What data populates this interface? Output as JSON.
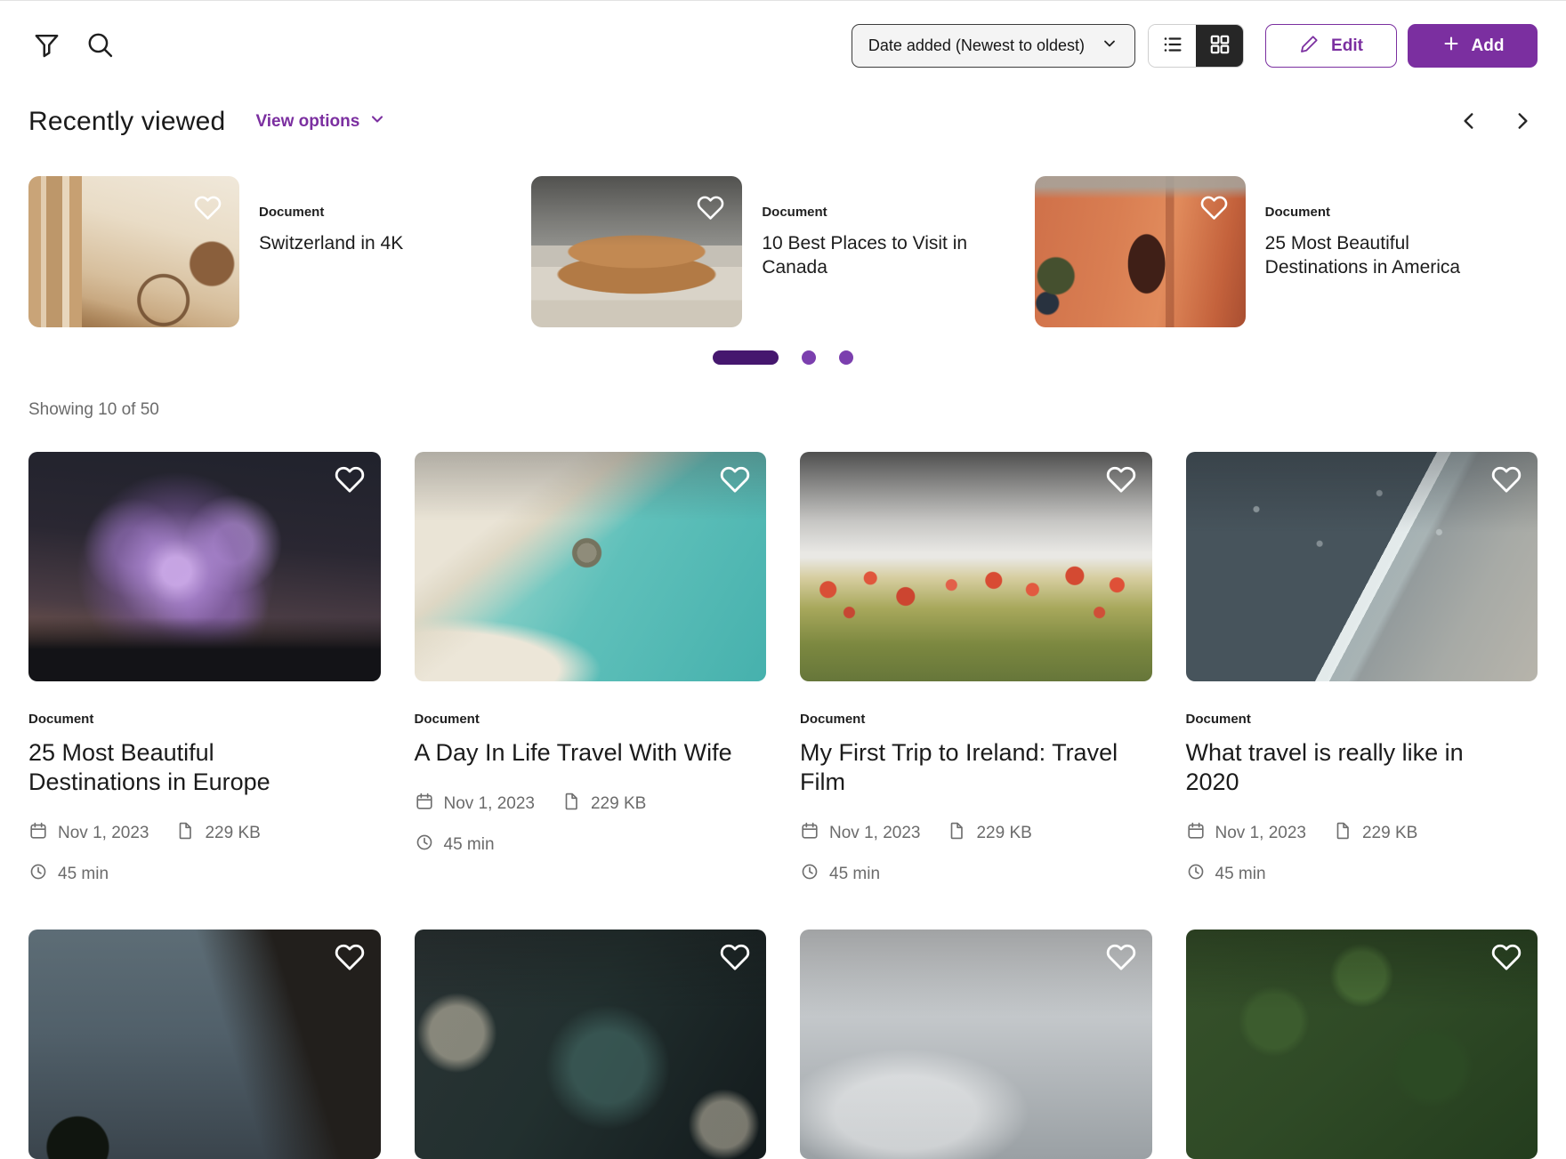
{
  "colors": {
    "accent_purple": "#7b2fa0",
    "pagination_active": "#45176e",
    "pagination_inactive": "#7b3fae",
    "text_dark": "#1b1b1b",
    "text_gray": "#6b6b6b"
  },
  "topbar": {
    "filter_icon": "filter-funnel",
    "search_icon": "magnifier",
    "sort_dropdown": {
      "value": "Date added (Newest to oldest)"
    },
    "view_toggle": {
      "options": [
        "list",
        "grid"
      ],
      "active": "grid"
    },
    "edit_button": "Edit",
    "add_button": "Add"
  },
  "section": {
    "title": "Recently viewed",
    "view_options": "View options",
    "showing": "Showing 10 of 50"
  },
  "carousel": {
    "items": [
      {
        "kind": "Document",
        "title": "Switzerland in 4K",
        "image": "bicycle-by-window"
      },
      {
        "kind": "Document",
        "title": "10 Best Places to Visit in Canada",
        "image": "tan-leather-sofa"
      },
      {
        "kind": "Document",
        "title": "25 Most Beautiful Destinations in America",
        "image": "terracotta-interior"
      }
    ],
    "pagination": {
      "total": 3,
      "active_index": 0
    }
  },
  "grid": {
    "cards": [
      {
        "kind": "Document",
        "title": "25 Most Beautiful Destinations in Europe",
        "date": "Nov 1, 2023",
        "size": "229 KB",
        "duration": "45 min",
        "image": "joshua-tree-night"
      },
      {
        "kind": "Document",
        "title": "A Day In Life Travel With Wife",
        "date": "Nov 1, 2023",
        "size": "229 KB",
        "duration": "45 min",
        "image": "aerial-beach"
      },
      {
        "kind": "Document",
        "title": "My First Trip to Ireland: Travel Film",
        "date": "Nov 1, 2023",
        "size": "229 KB",
        "duration": "45 min",
        "image": "poppy-field"
      },
      {
        "kind": "Document",
        "title": "What travel is really like in 2020",
        "date": "Nov 1, 2023",
        "size": "229 KB",
        "duration": "45 min",
        "image": "wet-sand-shore"
      }
    ],
    "partial_row_images": [
      "cliff-at-dusk",
      "dark-teal-bokeh",
      "misty-clouds",
      "forest-aerial"
    ]
  }
}
